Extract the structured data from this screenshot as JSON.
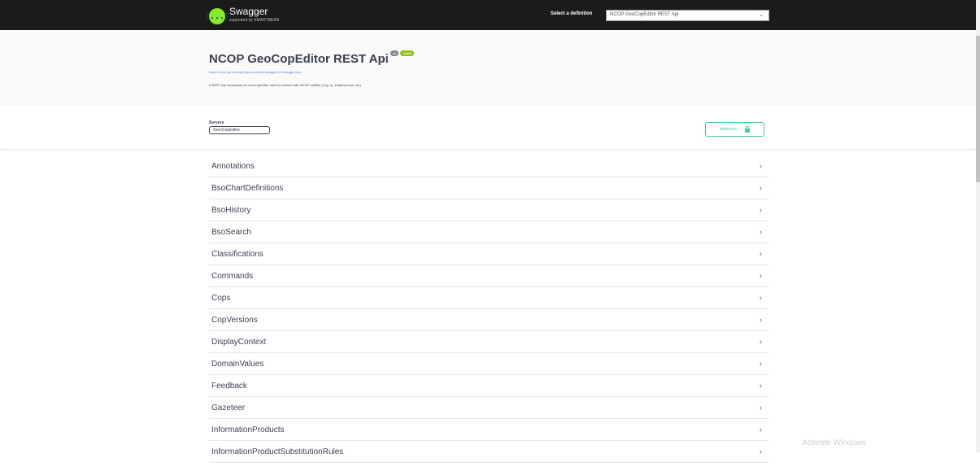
{
  "topbar": {
    "logo_icon": "{...}",
    "logo_text": "Swagger",
    "logo_sub": "supported by SMARTBEAR",
    "definition_label": "Select a definition",
    "definition_value": "NCOP GeoCopEditor REST Api",
    "dropdown_icon": "chevron-down-icon"
  },
  "info": {
    "title": "NCOP GeoCopEditor REST Api",
    "version_badge": "v1",
    "oas_badge": "OAS3",
    "spec_url": "https://ncop-api.example/geocopeditor/swagger/v1/swagger.json",
    "description": "A REST Api exclusively for GeoCopEditor client to interact with NCOP entities (Cop, Ip, DataSources, etc)"
  },
  "scheme": {
    "servers_label": "Servers",
    "server_value": "/GeoCopEditor",
    "authorize_label": "Authorize"
  },
  "tags": [
    {
      "name": "Annotations"
    },
    {
      "name": "BsoChartDefinitions"
    },
    {
      "name": "BsoHistory"
    },
    {
      "name": "BsoSearch"
    },
    {
      "name": "Classifications"
    },
    {
      "name": "Commands"
    },
    {
      "name": "Cops"
    },
    {
      "name": "CopVersions"
    },
    {
      "name": "DisplayContext"
    },
    {
      "name": "DomainValues"
    },
    {
      "name": "Feedback"
    },
    {
      "name": "Gazeteer"
    },
    {
      "name": "InformationProducts"
    },
    {
      "name": "InformationProductSubstitutionRules"
    }
  ],
  "chevron": "›",
  "watermark": "Activate Windows",
  "colors": {
    "topbar": "#1b1b1b",
    "accent_green": "#85ea2d",
    "authorize_green": "#49cc90",
    "link_blue": "#4990e2"
  }
}
